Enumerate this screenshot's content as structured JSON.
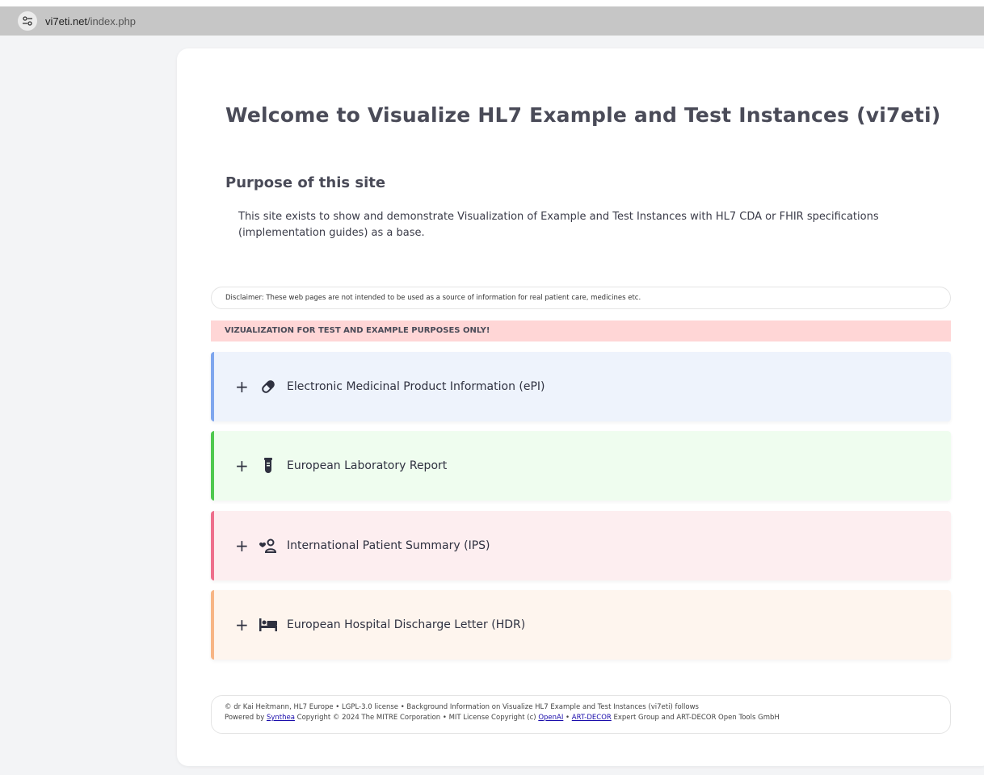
{
  "browser": {
    "url_host": "vi7eti.net",
    "url_path": "/index.php",
    "site_icon": "tune-icon"
  },
  "page": {
    "title": "Welcome to Visualize HL7 Example and Test Instances (vi7eti)",
    "purpose_heading": "Purpose of this site",
    "purpose_text": "This site exists to show and demonstrate Visualization of Example and Test Instances with HL7 CDA or FHIR specifications (implementation guides) as a base.",
    "disclaimer": "Disclaimer: These web pages are not intended to be used as a source of information for real patient care, medicines etc.",
    "warning": "VIZUALIZATION FOR TEST AND EXAMPLE PURPOSES ONLY!"
  },
  "sections": [
    {
      "label": "Electronic Medicinal Product Information (ePI)",
      "icon": "pill-icon",
      "accent": "#7fa6ee",
      "bg": "#eef3fc"
    },
    {
      "label": "European Laboratory Report",
      "icon": "test-tube-icon",
      "accent": "#4fc94f",
      "bg": "#effdef"
    },
    {
      "label": "International Patient Summary (IPS)",
      "icon": "patient-heart-icon",
      "accent": "#ee6f8c",
      "bg": "#fdeef0"
    },
    {
      "label": "European Hospital Discharge Letter (HDR)",
      "icon": "bed-icon",
      "accent": "#f7b585",
      "bg": "#fef5ee"
    }
  ],
  "expand_symbol": "+",
  "footer": {
    "line1": "© dr Kai Heitmann, HL7 Europe • LGPL-3.0 license • Background Information on Visualize HL7 Example and Test Instances (vi7eti) follows",
    "powered_by": "Powered by ",
    "synthea": "Synthea",
    "mitre": " Copyright © 2024 The MITRE Corporation • MIT License Copyright (c) ",
    "openai": "OpenAI",
    "sep": " • ",
    "artdecor": "ART-DECOR",
    "tail": " Expert Group and ART-DECOR Open Tools GmbH"
  }
}
